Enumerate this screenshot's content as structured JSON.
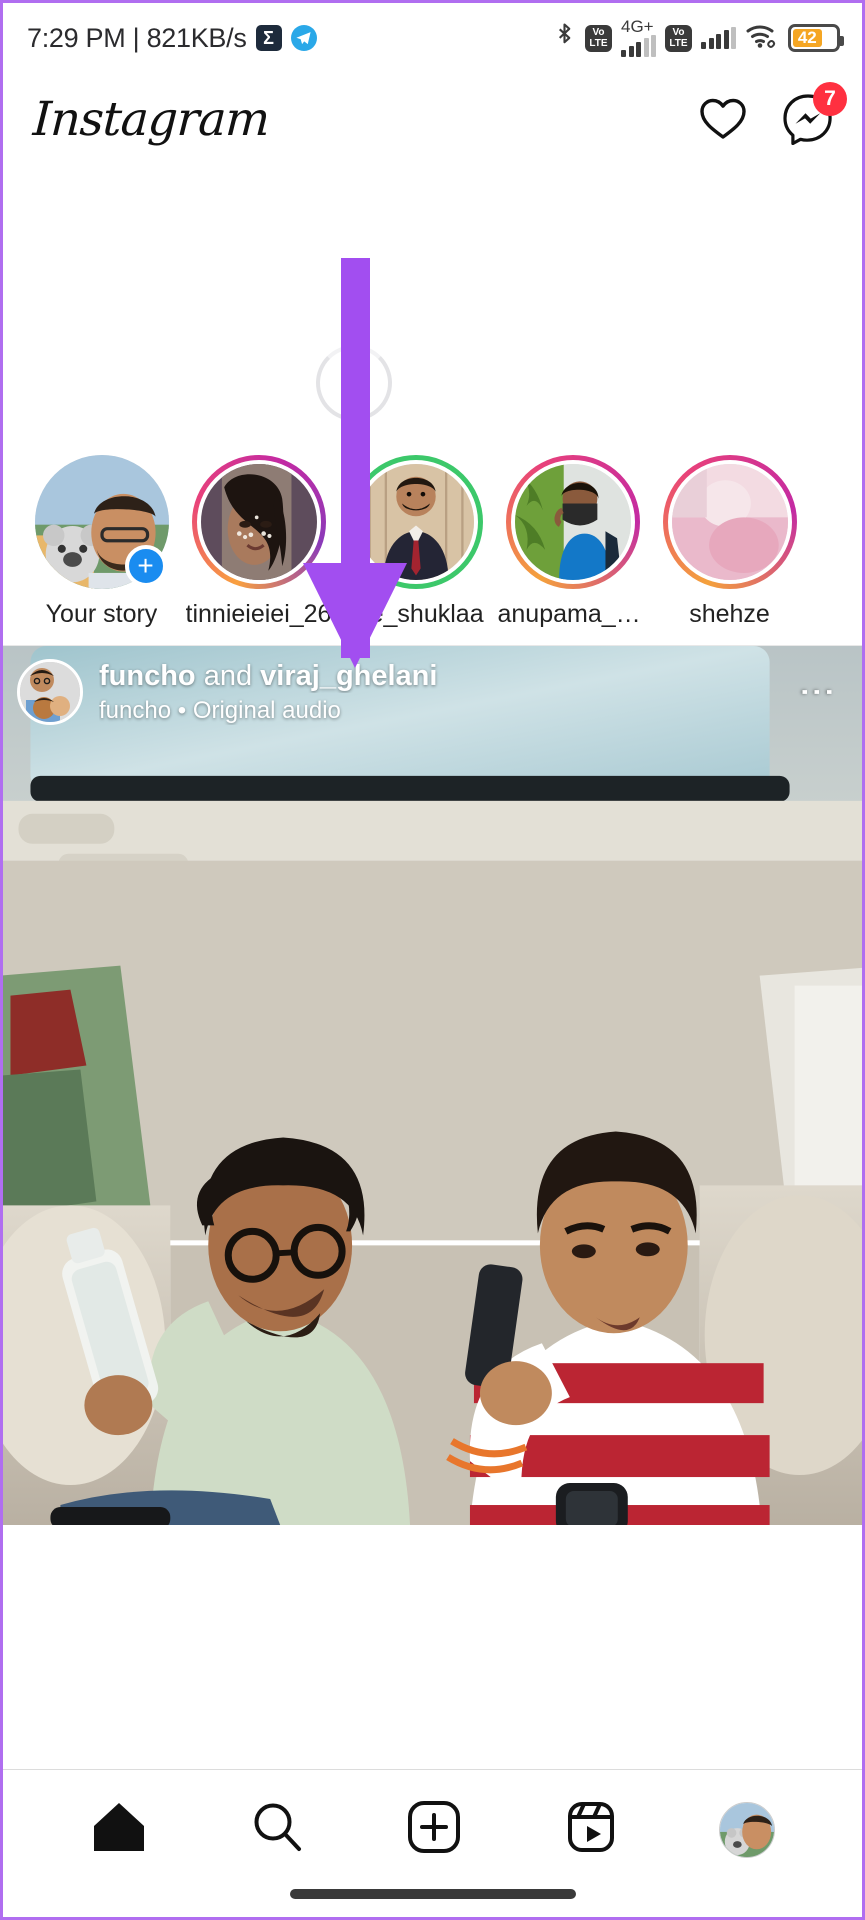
{
  "statusbar": {
    "time_network": "7:29 PM | 821KB/s",
    "sigma_icon": "sigma-app-icon",
    "telegram_icon": "telegram-icon",
    "bluetooth_icon": "bluetooth-icon",
    "volte_1": "VoLTE",
    "volte_2": "VoLTE",
    "network_type": "4G+",
    "wifi_icon": "wifi-icon",
    "battery_percent": "42"
  },
  "header": {
    "logo": "Instagram",
    "heart_icon": "heart-icon",
    "messenger_icon": "messenger-icon",
    "messenger_badge": "7"
  },
  "refresh": {
    "spinner": "loading-spinner"
  },
  "stories": {
    "items": [
      {
        "label": "Your story",
        "has_add": true,
        "ring": "none",
        "bg1": "#8fb7d6",
        "bg2": "#c9d8c4"
      },
      {
        "label": "tinnieieiei_26",
        "has_add": false,
        "ring": "gradient",
        "bg1": "#6d5a6b",
        "bg2": "#3a2c33"
      },
      {
        "label": "dre_shuklaa",
        "has_add": false,
        "ring": "green",
        "bg1": "#c9a98c",
        "bg2": "#2b2b38"
      },
      {
        "label": "anupama_vi...",
        "has_add": false,
        "ring": "gradient",
        "bg1": "#6f9a3c",
        "bg2": "#1f6fc0"
      },
      {
        "label": "shehze",
        "has_add": false,
        "ring": "gradient",
        "bg1": "#f0c8d4",
        "bg2": "#e6b7c6"
      }
    ]
  },
  "post": {
    "title_user": "funcho",
    "title_conj": " and ",
    "title_collab": "viraj_ghelani",
    "sub_user": "funcho",
    "sub_dot": "•",
    "sub_audio": "Original audio",
    "more_icon": "more-options-icon"
  },
  "bottomnav": {
    "items": [
      {
        "name": "home",
        "icon": "home-icon",
        "active": true
      },
      {
        "name": "search",
        "icon": "search-icon",
        "active": false
      },
      {
        "name": "create",
        "icon": "plus-square-icon",
        "active": false
      },
      {
        "name": "reels",
        "icon": "reels-icon",
        "active": false
      },
      {
        "name": "profile",
        "icon": "profile-avatar",
        "active": false
      }
    ]
  },
  "annotation": {
    "arrow_color": "#a24ef0",
    "arrow_name": "purple-down-arrow"
  }
}
